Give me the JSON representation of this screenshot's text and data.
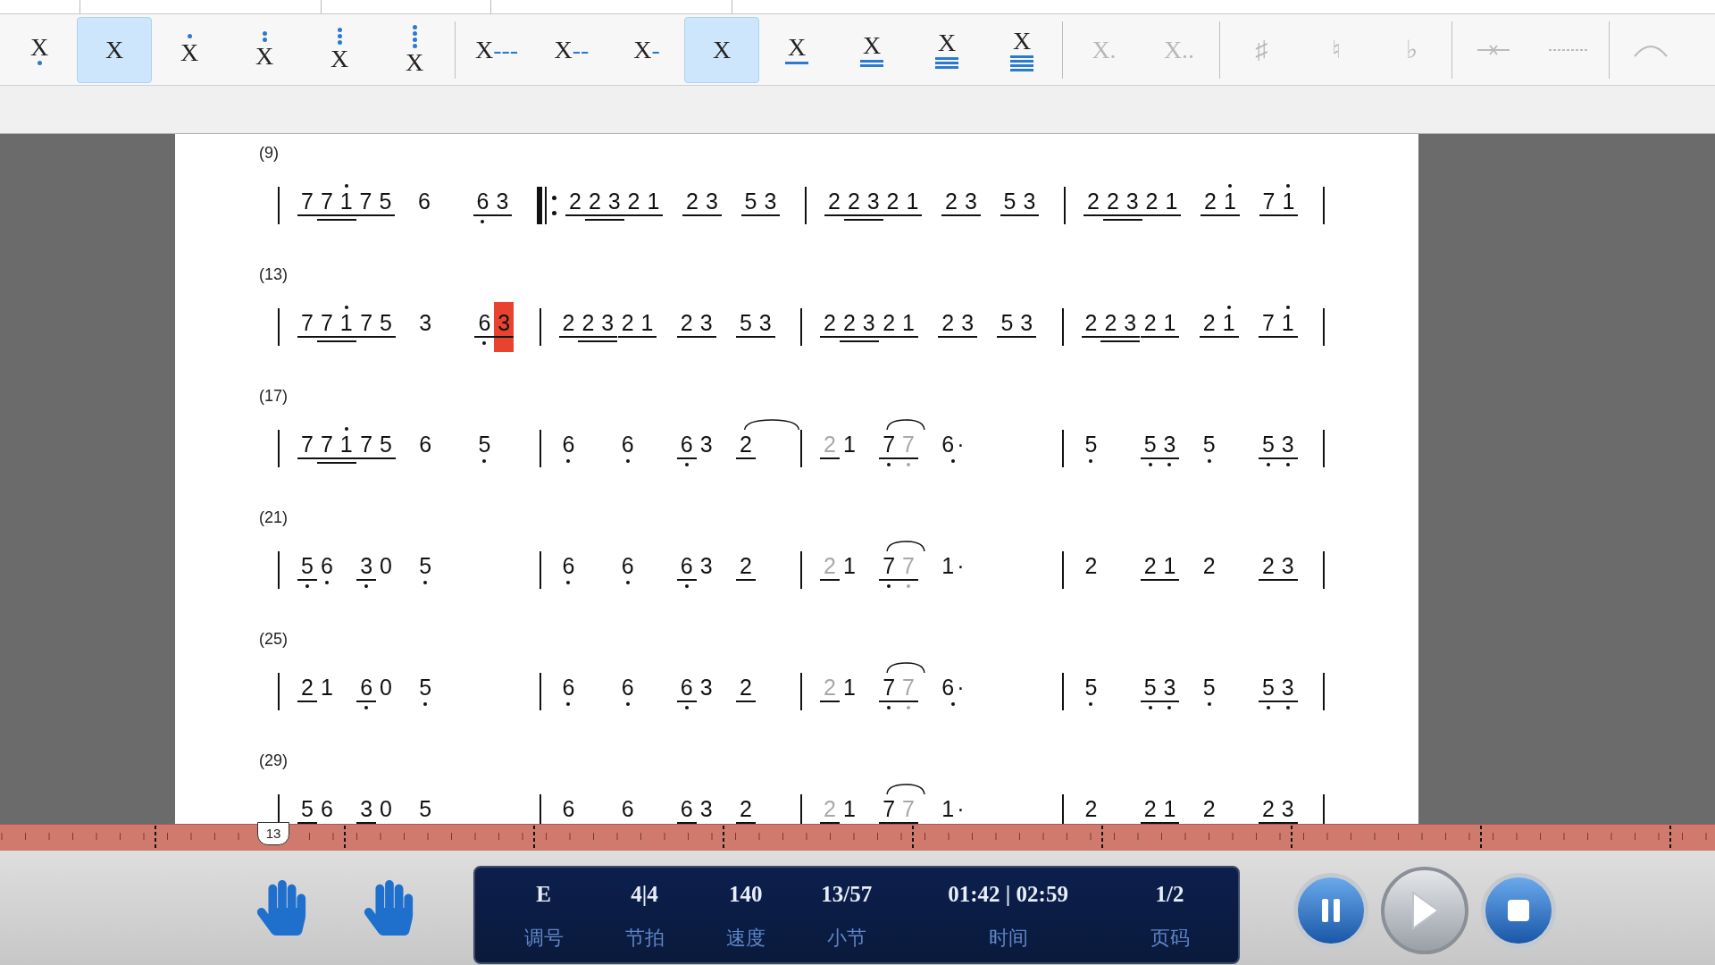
{
  "toolbar": [
    [
      {
        "kind": "low",
        "label": "X",
        "selected": false,
        "disabled": false
      },
      {
        "kind": "plain",
        "label": "X",
        "selected": true,
        "disabled": false
      },
      {
        "kind": "high1",
        "label": "X",
        "selected": false,
        "disabled": false
      },
      {
        "kind": "high2",
        "label": "X",
        "selected": false,
        "disabled": false
      },
      {
        "kind": "high3",
        "label": "X",
        "selected": false,
        "disabled": false
      },
      {
        "kind": "high4",
        "label": "X",
        "selected": false,
        "disabled": false
      }
    ],
    [
      {
        "kind": "dash",
        "label": "X",
        "suffix": "---",
        "selected": false,
        "disabled": false
      },
      {
        "kind": "dash",
        "label": "X",
        "suffix": "--",
        "selected": false,
        "disabled": false
      },
      {
        "kind": "dash",
        "label": "X",
        "suffix": "-",
        "selected": false,
        "disabled": false
      },
      {
        "kind": "plain",
        "label": "X",
        "selected": true,
        "disabled": false
      },
      {
        "kind": "under1",
        "label": "X",
        "selected": false,
        "disabled": false
      },
      {
        "kind": "under2",
        "label": "X",
        "selected": false,
        "disabled": false
      },
      {
        "kind": "under3",
        "label": "X",
        "selected": false,
        "disabled": false
      },
      {
        "kind": "under4",
        "label": "X",
        "selected": false,
        "disabled": false
      }
    ],
    [
      {
        "kind": "plain",
        "label": "X.",
        "selected": false,
        "disabled": true
      },
      {
        "kind": "plain",
        "label": "X..",
        "selected": false,
        "disabled": true
      }
    ],
    [
      {
        "kind": "plain",
        "label": "♯",
        "selected": false,
        "disabled": true
      },
      {
        "kind": "plain",
        "label": "♮",
        "selected": false,
        "disabled": true
      },
      {
        "kind": "plain",
        "label": "♭",
        "selected": false,
        "disabled": true
      }
    ],
    [
      {
        "kind": "strike",
        "selected": false,
        "disabled": true
      },
      {
        "kind": "dashline",
        "selected": false,
        "disabled": true
      }
    ],
    [
      {
        "kind": "arc",
        "selected": false,
        "disabled": true
      }
    ]
  ],
  "systems": [
    {
      "label": "(9)",
      "measures": [
        {
          "repeat_start": false,
          "groups": [
            [
              {
                "n": "7",
                "beam": true
              },
              {
                "n": "7",
                "beam": true,
                "beam2": true
              },
              {
                "n": "1",
                "beam": true,
                "beam2": true,
                "high": true
              }
            ],
            [
              {
                "n": "7",
                "beam": true
              },
              {
                "n": "5",
                "beam": true
              }
            ],
            [
              {
                "n": "6"
              }
            ],
            [
              {
                "n": "6",
                "beam": true,
                "low": true
              },
              {
                "n": "3",
                "beam": true
              }
            ]
          ]
        },
        {
          "repeat_start": true,
          "groups": [
            [
              {
                "n": "2",
                "beam": true
              },
              {
                "n": "2",
                "beam": true,
                "beam2": true
              },
              {
                "n": "3",
                "beam": true,
                "beam2": true
              }
            ],
            [
              {
                "n": "2",
                "beam": true
              },
              {
                "n": "1",
                "beam": true
              }
            ],
            [
              {
                "n": "2",
                "beam": true
              },
              {
                "n": "3",
                "beam": true
              }
            ],
            [
              {
                "n": "5",
                "beam": true
              },
              {
                "n": "3",
                "beam": true
              }
            ]
          ]
        },
        {
          "repeat_start": false,
          "groups": [
            [
              {
                "n": "2",
                "beam": true
              },
              {
                "n": "2",
                "beam": true,
                "beam2": true
              },
              {
                "n": "3",
                "beam": true,
                "beam2": true
              }
            ],
            [
              {
                "n": "2",
                "beam": true
              },
              {
                "n": "1",
                "beam": true
              }
            ],
            [
              {
                "n": "2",
                "beam": true
              },
              {
                "n": "3",
                "beam": true
              }
            ],
            [
              {
                "n": "5",
                "beam": true
              },
              {
                "n": "3",
                "beam": true
              }
            ]
          ]
        },
        {
          "repeat_start": false,
          "groups": [
            [
              {
                "n": "2",
                "beam": true
              },
              {
                "n": "2",
                "beam": true,
                "beam2": true
              },
              {
                "n": "3",
                "beam": true,
                "beam2": true
              }
            ],
            [
              {
                "n": "2",
                "beam": true
              },
              {
                "n": "1",
                "beam": true
              }
            ],
            [
              {
                "n": "2",
                "beam": true
              },
              {
                "n": "1",
                "beam": true,
                "high": true
              }
            ],
            [
              {
                "n": "7",
                "beam": true
              },
              {
                "n": "1",
                "beam": true,
                "high": true
              }
            ]
          ]
        }
      ]
    },
    {
      "label": "(13)",
      "measures": [
        {
          "repeat_start": false,
          "groups": [
            [
              {
                "n": "7",
                "beam": true
              },
              {
                "n": "7",
                "beam": true,
                "beam2": true
              },
              {
                "n": "1",
                "beam": true,
                "beam2": true,
                "high": true
              }
            ],
            [
              {
                "n": "7",
                "beam": true
              },
              {
                "n": "5",
                "beam": true
              }
            ],
            [
              {
                "n": "3"
              }
            ],
            [
              {
                "n": "6",
                "beam": true,
                "low": true
              },
              {
                "n": "3",
                "beam": true,
                "cursor": true
              }
            ]
          ]
        },
        {
          "repeat_start": false,
          "groups": [
            [
              {
                "n": "2",
                "beam": true
              },
              {
                "n": "2",
                "beam": true,
                "beam2": true
              },
              {
                "n": "3",
                "beam": true,
                "beam2": true
              }
            ],
            [
              {
                "n": "2",
                "beam": true
              },
              {
                "n": "1",
                "beam": true
              }
            ],
            [
              {
                "n": "2",
                "beam": true
              },
              {
                "n": "3",
                "beam": true
              }
            ],
            [
              {
                "n": "5",
                "beam": true
              },
              {
                "n": "3",
                "beam": true
              }
            ]
          ]
        },
        {
          "repeat_start": false,
          "groups": [
            [
              {
                "n": "2",
                "beam": true
              },
              {
                "n": "2",
                "beam": true,
                "beam2": true
              },
              {
                "n": "3",
                "beam": true,
                "beam2": true
              }
            ],
            [
              {
                "n": "2",
                "beam": true
              },
              {
                "n": "1",
                "beam": true
              }
            ],
            [
              {
                "n": "2",
                "beam": true
              },
              {
                "n": "3",
                "beam": true
              }
            ],
            [
              {
                "n": "5",
                "beam": true
              },
              {
                "n": "3",
                "beam": true
              }
            ]
          ]
        },
        {
          "repeat_start": false,
          "groups": [
            [
              {
                "n": "2",
                "beam": true
              },
              {
                "n": "2",
                "beam": true,
                "beam2": true
              },
              {
                "n": "3",
                "beam": true,
                "beam2": true
              }
            ],
            [
              {
                "n": "2",
                "beam": true
              },
              {
                "n": "1",
                "beam": true
              }
            ],
            [
              {
                "n": "2",
                "beam": true
              },
              {
                "n": "1",
                "beam": true,
                "high": true
              }
            ],
            [
              {
                "n": "7",
                "beam": true
              },
              {
                "n": "1",
                "beam": true,
                "high": true
              }
            ]
          ]
        }
      ]
    },
    {
      "label": "(17)",
      "measures": [
        {
          "repeat_start": false,
          "groups": [
            [
              {
                "n": "7",
                "beam": true
              },
              {
                "n": "7",
                "beam": true,
                "beam2": true
              },
              {
                "n": "1",
                "beam": true,
                "beam2": true,
                "high": true
              }
            ],
            [
              {
                "n": "7",
                "beam": true
              },
              {
                "n": "5",
                "beam": true
              }
            ],
            [
              {
                "n": "6"
              }
            ],
            [
              {
                "n": "5",
                "low": true
              }
            ]
          ]
        },
        {
          "repeat_start": false,
          "groups": [
            [
              {
                "n": "6",
                "low": true
              }
            ],
            [
              {
                "n": "6",
                "low": true
              }
            ],
            [
              {
                "n": "6",
                "beam": true,
                "low": true
              },
              {
                "n": "3"
              }
            ],
            [
              {
                "n": "2",
                "beam": true,
                "tie": true
              }
            ]
          ]
        },
        {
          "repeat_start": false,
          "groups": [
            [
              {
                "n": "2",
                "beam": true,
                "faded": true
              },
              {
                "n": "1"
              }
            ],
            [
              {
                "n": "7",
                "beam": true,
                "low": true,
                "tie": true
              },
              {
                "n": "7",
                "beam": true,
                "low": true,
                "faded": true
              }
            ],
            [
              {
                "n": "6",
                "low": true,
                "ext": "·"
              }
            ]
          ]
        },
        {
          "repeat_start": false,
          "groups": [
            [
              {
                "n": "5",
                "low": true
              }
            ],
            [
              {
                "n": "5",
                "beam": true,
                "low": true
              },
              {
                "n": "3",
                "beam": true,
                "low": true
              }
            ],
            [
              {
                "n": "5",
                "low": true
              }
            ],
            [
              {
                "n": "5",
                "beam": true,
                "low": true
              },
              {
                "n": "3",
                "beam": true,
                "low": true
              }
            ]
          ]
        }
      ]
    },
    {
      "label": "(21)",
      "measures": [
        {
          "repeat_start": false,
          "groups": [
            [
              {
                "n": "5",
                "beam": true,
                "low": true
              },
              {
                "n": "6",
                "low": true
              }
            ],
            [
              {
                "n": "3",
                "beam": true,
                "low": true
              },
              {
                "n": "0"
              }
            ],
            [
              {
                "n": "5",
                "low": true
              }
            ]
          ]
        },
        {
          "repeat_start": false,
          "groups": [
            [
              {
                "n": "6",
                "low": true
              }
            ],
            [
              {
                "n": "6",
                "low": true
              }
            ],
            [
              {
                "n": "6",
                "beam": true,
                "low": true
              },
              {
                "n": "3"
              }
            ],
            [
              {
                "n": "2",
                "beam": true
              }
            ]
          ]
        },
        {
          "repeat_start": false,
          "groups": [
            [
              {
                "n": "2",
                "beam": true,
                "faded": true
              },
              {
                "n": "1"
              }
            ],
            [
              {
                "n": "7",
                "beam": true,
                "low": true,
                "tie": true
              },
              {
                "n": "7",
                "beam": true,
                "low": true,
                "faded": true
              }
            ],
            [
              {
                "n": "1",
                "ext": "·"
              }
            ]
          ]
        },
        {
          "repeat_start": false,
          "groups": [
            [
              {
                "n": "2"
              }
            ],
            [
              {
                "n": "2",
                "beam": true
              },
              {
                "n": "1",
                "beam": true
              }
            ],
            [
              {
                "n": "2"
              }
            ],
            [
              {
                "n": "2",
                "beam": true
              },
              {
                "n": "3",
                "beam": true
              }
            ]
          ]
        }
      ]
    },
    {
      "label": "(25)",
      "measures": [
        {
          "repeat_start": false,
          "groups": [
            [
              {
                "n": "2",
                "beam": true
              },
              {
                "n": "1"
              }
            ],
            [
              {
                "n": "6",
                "beam": true,
                "low": true
              },
              {
                "n": "0"
              }
            ],
            [
              {
                "n": "5",
                "low": true
              }
            ]
          ]
        },
        {
          "repeat_start": false,
          "groups": [
            [
              {
                "n": "6",
                "low": true
              }
            ],
            [
              {
                "n": "6",
                "low": true
              }
            ],
            [
              {
                "n": "6",
                "beam": true,
                "low": true
              },
              {
                "n": "3"
              }
            ],
            [
              {
                "n": "2",
                "beam": true
              }
            ]
          ]
        },
        {
          "repeat_start": false,
          "groups": [
            [
              {
                "n": "2",
                "beam": true,
                "faded": true
              },
              {
                "n": "1"
              }
            ],
            [
              {
                "n": "7",
                "beam": true,
                "low": true,
                "tie": true
              },
              {
                "n": "7",
                "beam": true,
                "low": true,
                "faded": true
              }
            ],
            [
              {
                "n": "6",
                "low": true,
                "ext": "·"
              }
            ]
          ]
        },
        {
          "repeat_start": false,
          "groups": [
            [
              {
                "n": "5",
                "low": true
              }
            ],
            [
              {
                "n": "5",
                "beam": true,
                "low": true
              },
              {
                "n": "3",
                "beam": true,
                "low": true
              }
            ],
            [
              {
                "n": "5",
                "low": true
              }
            ],
            [
              {
                "n": "5",
                "beam": true,
                "low": true
              },
              {
                "n": "3",
                "beam": true,
                "low": true
              }
            ]
          ]
        }
      ]
    },
    {
      "label": "(29)",
      "measures": [
        {
          "repeat_start": false,
          "groups": [
            [
              {
                "n": "5",
                "beam": true
              },
              {
                "n": "6"
              }
            ],
            [
              {
                "n": "3",
                "beam": true
              },
              {
                "n": "0"
              }
            ],
            [
              {
                "n": "5"
              }
            ]
          ]
        },
        {
          "repeat_start": false,
          "groups": [
            [
              {
                "n": "6"
              }
            ],
            [
              {
                "n": "6"
              }
            ],
            [
              {
                "n": "6",
                "beam": true
              },
              {
                "n": "3"
              }
            ],
            [
              {
                "n": "2",
                "beam": true
              }
            ]
          ]
        },
        {
          "repeat_start": false,
          "groups": [
            [
              {
                "n": "2",
                "beam": true,
                "faded": true
              },
              {
                "n": "1"
              }
            ],
            [
              {
                "n": "7",
                "beam": true,
                "tie": true
              },
              {
                "n": "7",
                "beam": true,
                "faded": true
              }
            ],
            [
              {
                "n": "1",
                "ext": "·"
              }
            ]
          ]
        },
        {
          "repeat_start": false,
          "groups": [
            [
              {
                "n": "2"
              }
            ],
            [
              {
                "n": "2",
                "beam": true
              },
              {
                "n": "1",
                "beam": true
              }
            ],
            [
              {
                "n": "2"
              }
            ],
            [
              {
                "n": "2",
                "beam": true
              },
              {
                "n": "3",
                "beam": true
              }
            ]
          ]
        }
      ]
    }
  ],
  "ruler": {
    "marker": "13"
  },
  "display": [
    {
      "value": "E",
      "label": "调号"
    },
    {
      "value": "4|4",
      "label": "节拍"
    },
    {
      "value": "140",
      "label": "速度"
    },
    {
      "value": "13/57",
      "label": "小节"
    },
    {
      "value": "01:42 | 02:59",
      "label": "时间"
    },
    {
      "value": "1/2",
      "label": "页码"
    }
  ]
}
